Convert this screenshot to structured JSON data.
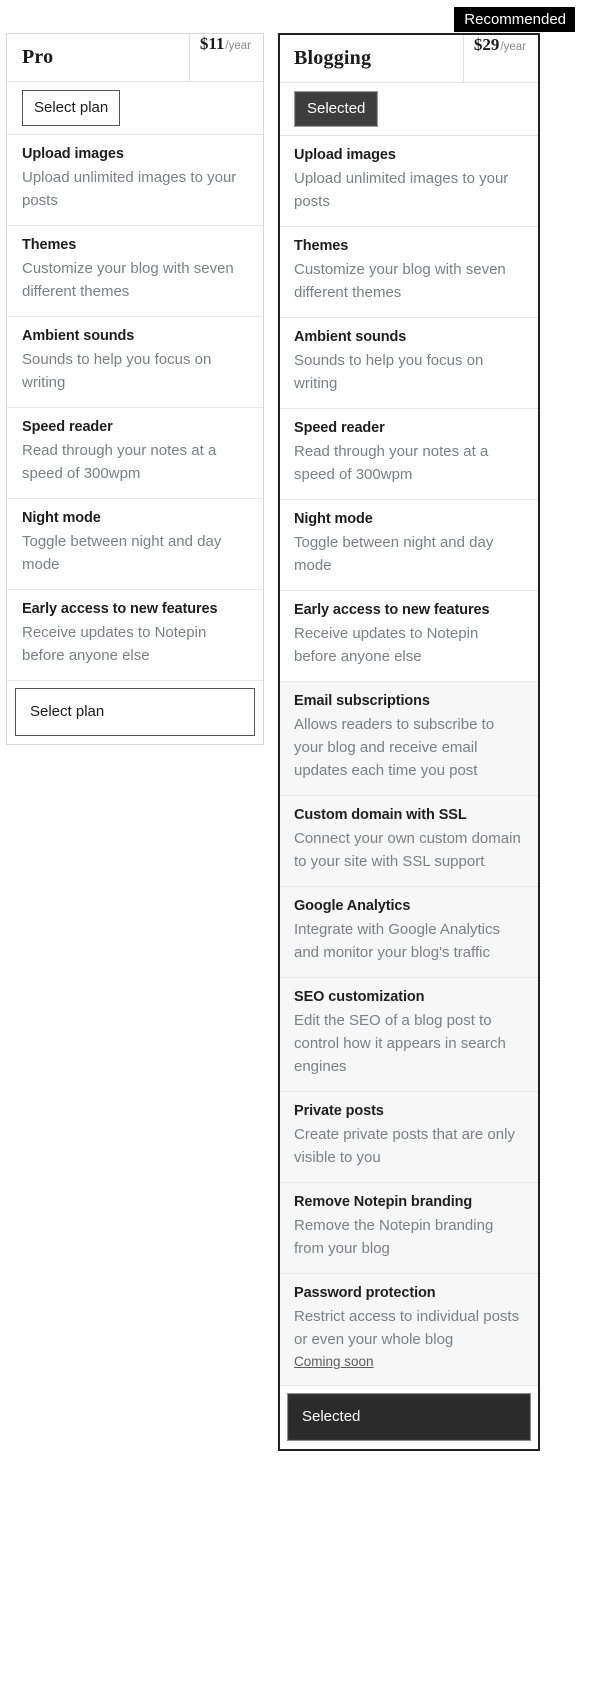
{
  "badge": {
    "label": "Recommended"
  },
  "plans": [
    {
      "id": "pro",
      "name": "Pro",
      "price_amount": "$11",
      "price_period": "/year",
      "recommended": false,
      "selected": false,
      "top_button_label": "Select plan",
      "bottom_button_label": "Select plan",
      "features": [
        {
          "title": "Upload images",
          "description": "Upload unlimited images to your posts",
          "shaded": false
        },
        {
          "title": "Themes",
          "description": "Customize your blog with seven different themes",
          "shaded": false
        },
        {
          "title": "Ambient sounds",
          "description": "Sounds to help you focus on writing",
          "shaded": false
        },
        {
          "title": "Speed reader",
          "description": "Read through your notes at a speed of 300wpm",
          "shaded": false
        },
        {
          "title": "Night mode",
          "description": "Toggle between night and day mode",
          "shaded": false
        },
        {
          "title": "Early access to new features",
          "description": "Receive updates to Notepin before anyone else",
          "shaded": false
        }
      ]
    },
    {
      "id": "blogging",
      "name": "Blogging",
      "price_amount": "$29",
      "price_period": "/year",
      "recommended": true,
      "selected": true,
      "top_button_label": "Selected",
      "bottom_button_label": "Selected",
      "features": [
        {
          "title": "Upload images",
          "description": "Upload unlimited images to your posts",
          "shaded": false
        },
        {
          "title": "Themes",
          "description": "Customize your blog with seven different themes",
          "shaded": false
        },
        {
          "title": "Ambient sounds",
          "description": "Sounds to help you focus on writing",
          "shaded": false
        },
        {
          "title": "Speed reader",
          "description": "Read through your notes at a speed of 300wpm",
          "shaded": false
        },
        {
          "title": "Night mode",
          "description": "Toggle between night and day mode",
          "shaded": false
        },
        {
          "title": "Early access to new features",
          "description": "Receive updates to Notepin before anyone else",
          "shaded": false
        },
        {
          "title": "Email subscriptions",
          "description": "Allows readers to subscribe to your blog and receive email updates each time you post",
          "shaded": true
        },
        {
          "title": "Custom domain with SSL",
          "description": "Connect your own custom domain to your site with SSL support",
          "shaded": true
        },
        {
          "title": "Google Analytics",
          "description": "Integrate with Google Analytics and monitor your blog's traffic",
          "shaded": true
        },
        {
          "title": "SEO customization",
          "description": "Edit the SEO of a blog post to control how it appears in search engines",
          "shaded": true
        },
        {
          "title": "Private posts",
          "description": "Create private posts that are only visible to you",
          "shaded": true
        },
        {
          "title": "Remove Notepin branding",
          "description": "Remove the Notepin branding from your blog",
          "shaded": true
        },
        {
          "title": "Password protection",
          "description": "Restrict access to individual posts or even your whole blog",
          "note": "Coming soon",
          "shaded": true
        }
      ]
    }
  ],
  "colors": {
    "badge_background": "#000000",
    "badge_text": "#ffffff",
    "featured_border": "#222222",
    "plain_border": "#d8d8d8",
    "selected_button_background": "#2b2b2b",
    "description_text": "#7b7f86",
    "shaded_row_background": "#f7f7f7"
  }
}
